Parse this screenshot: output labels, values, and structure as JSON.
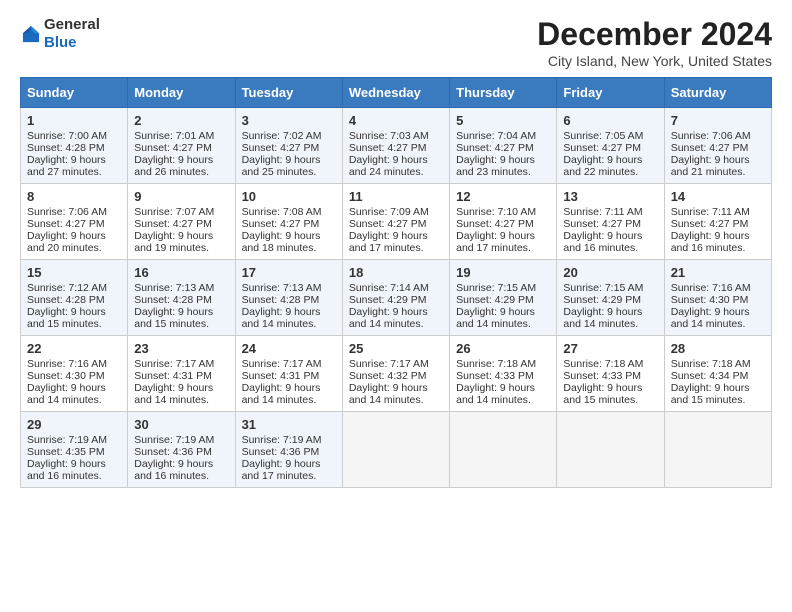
{
  "header": {
    "logo_line1": "General",
    "logo_line2": "Blue",
    "title": "December 2024",
    "subtitle": "City Island, New York, United States"
  },
  "weekdays": [
    "Sunday",
    "Monday",
    "Tuesday",
    "Wednesday",
    "Thursday",
    "Friday",
    "Saturday"
  ],
  "weeks": [
    [
      {
        "day": "1",
        "sunrise": "7:00 AM",
        "sunset": "4:28 PM",
        "daylight": "9 hours and 27 minutes."
      },
      {
        "day": "2",
        "sunrise": "7:01 AM",
        "sunset": "4:27 PM",
        "daylight": "9 hours and 26 minutes."
      },
      {
        "day": "3",
        "sunrise": "7:02 AM",
        "sunset": "4:27 PM",
        "daylight": "9 hours and 25 minutes."
      },
      {
        "day": "4",
        "sunrise": "7:03 AM",
        "sunset": "4:27 PM",
        "daylight": "9 hours and 24 minutes."
      },
      {
        "day": "5",
        "sunrise": "7:04 AM",
        "sunset": "4:27 PM",
        "daylight": "9 hours and 23 minutes."
      },
      {
        "day": "6",
        "sunrise": "7:05 AM",
        "sunset": "4:27 PM",
        "daylight": "9 hours and 22 minutes."
      },
      {
        "day": "7",
        "sunrise": "7:06 AM",
        "sunset": "4:27 PM",
        "daylight": "9 hours and 21 minutes."
      }
    ],
    [
      {
        "day": "8",
        "sunrise": "7:06 AM",
        "sunset": "4:27 PM",
        "daylight": "9 hours and 20 minutes."
      },
      {
        "day": "9",
        "sunrise": "7:07 AM",
        "sunset": "4:27 PM",
        "daylight": "9 hours and 19 minutes."
      },
      {
        "day": "10",
        "sunrise": "7:08 AM",
        "sunset": "4:27 PM",
        "daylight": "9 hours and 18 minutes."
      },
      {
        "day": "11",
        "sunrise": "7:09 AM",
        "sunset": "4:27 PM",
        "daylight": "9 hours and 17 minutes."
      },
      {
        "day": "12",
        "sunrise": "7:10 AM",
        "sunset": "4:27 PM",
        "daylight": "9 hours and 17 minutes."
      },
      {
        "day": "13",
        "sunrise": "7:11 AM",
        "sunset": "4:27 PM",
        "daylight": "9 hours and 16 minutes."
      },
      {
        "day": "14",
        "sunrise": "7:11 AM",
        "sunset": "4:27 PM",
        "daylight": "9 hours and 16 minutes."
      }
    ],
    [
      {
        "day": "15",
        "sunrise": "7:12 AM",
        "sunset": "4:28 PM",
        "daylight": "9 hours and 15 minutes."
      },
      {
        "day": "16",
        "sunrise": "7:13 AM",
        "sunset": "4:28 PM",
        "daylight": "9 hours and 15 minutes."
      },
      {
        "day": "17",
        "sunrise": "7:13 AM",
        "sunset": "4:28 PM",
        "daylight": "9 hours and 14 minutes."
      },
      {
        "day": "18",
        "sunrise": "7:14 AM",
        "sunset": "4:29 PM",
        "daylight": "9 hours and 14 minutes."
      },
      {
        "day": "19",
        "sunrise": "7:15 AM",
        "sunset": "4:29 PM",
        "daylight": "9 hours and 14 minutes."
      },
      {
        "day": "20",
        "sunrise": "7:15 AM",
        "sunset": "4:29 PM",
        "daylight": "9 hours and 14 minutes."
      },
      {
        "day": "21",
        "sunrise": "7:16 AM",
        "sunset": "4:30 PM",
        "daylight": "9 hours and 14 minutes."
      }
    ],
    [
      {
        "day": "22",
        "sunrise": "7:16 AM",
        "sunset": "4:30 PM",
        "daylight": "9 hours and 14 minutes."
      },
      {
        "day": "23",
        "sunrise": "7:17 AM",
        "sunset": "4:31 PM",
        "daylight": "9 hours and 14 minutes."
      },
      {
        "day": "24",
        "sunrise": "7:17 AM",
        "sunset": "4:31 PM",
        "daylight": "9 hours and 14 minutes."
      },
      {
        "day": "25",
        "sunrise": "7:17 AM",
        "sunset": "4:32 PM",
        "daylight": "9 hours and 14 minutes."
      },
      {
        "day": "26",
        "sunrise": "7:18 AM",
        "sunset": "4:33 PM",
        "daylight": "9 hours and 14 minutes."
      },
      {
        "day": "27",
        "sunrise": "7:18 AM",
        "sunset": "4:33 PM",
        "daylight": "9 hours and 15 minutes."
      },
      {
        "day": "28",
        "sunrise": "7:18 AM",
        "sunset": "4:34 PM",
        "daylight": "9 hours and 15 minutes."
      }
    ],
    [
      {
        "day": "29",
        "sunrise": "7:19 AM",
        "sunset": "4:35 PM",
        "daylight": "9 hours and 16 minutes."
      },
      {
        "day": "30",
        "sunrise": "7:19 AM",
        "sunset": "4:36 PM",
        "daylight": "9 hours and 16 minutes."
      },
      {
        "day": "31",
        "sunrise": "7:19 AM",
        "sunset": "4:36 PM",
        "daylight": "9 hours and 17 minutes."
      },
      null,
      null,
      null,
      null
    ]
  ],
  "labels": {
    "sunrise": "Sunrise:",
    "sunset": "Sunset:",
    "daylight": "Daylight:"
  }
}
